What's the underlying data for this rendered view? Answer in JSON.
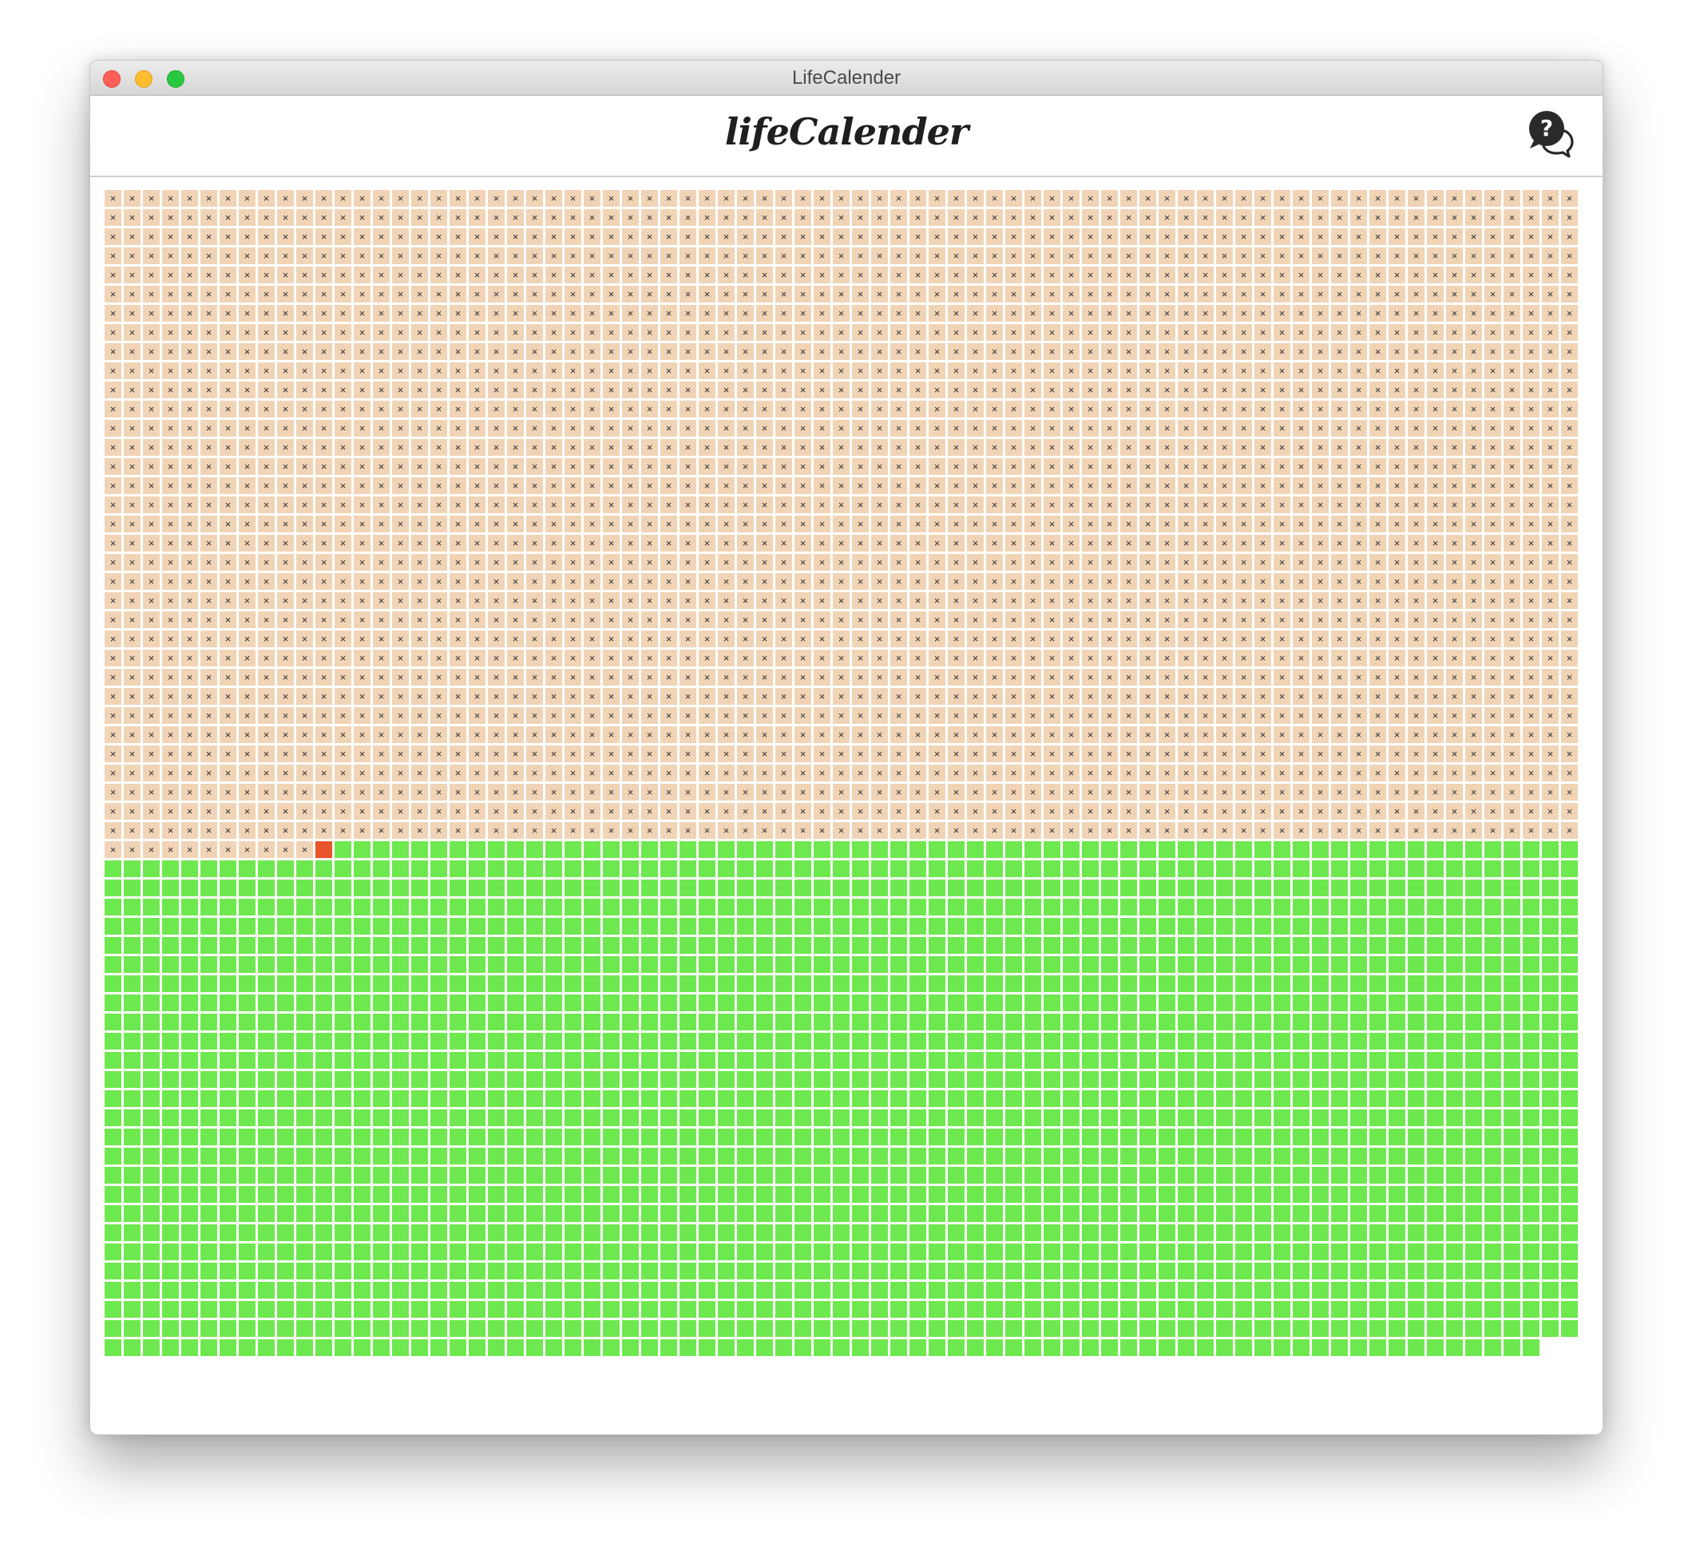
{
  "window": {
    "title": "LifeCalender"
  },
  "header": {
    "logo_text": "lifeCalender",
    "help_icon": "help-chat-icon"
  },
  "calendar": {
    "columns": 77,
    "total_weeks": 4695,
    "weeks_lived": 2629,
    "current_week_index": 2629,
    "lived_marker": "×",
    "colors": {
      "past": "#f1d4b6",
      "current": "#e8552a",
      "future": "#6ee84f"
    }
  }
}
